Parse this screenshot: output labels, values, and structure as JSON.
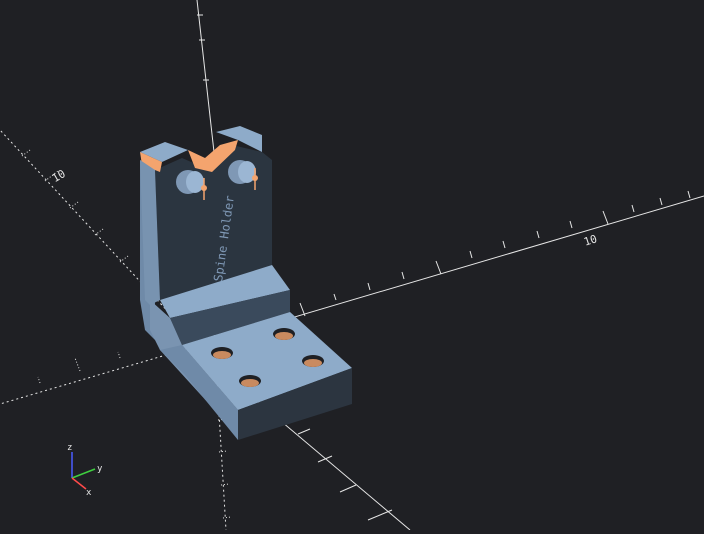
{
  "viewport": {
    "background": "#1f2024",
    "axis_color": "#e6e6e6",
    "model_color": "#8eabc9",
    "highlight_color": "#f4a46e",
    "hole_color": "#c98a5f"
  },
  "model": {
    "engraved_text": "Spine Holder"
  },
  "axis_labels": {
    "y_neg_tick": "10",
    "x_pos_tick": "10"
  },
  "orientation_gizmo": {
    "z_label": "z",
    "y_label": "y",
    "x_label": "x",
    "z_color": "#4a5cff",
    "y_color": "#3fcf3f",
    "x_color": "#ff4a4a"
  }
}
